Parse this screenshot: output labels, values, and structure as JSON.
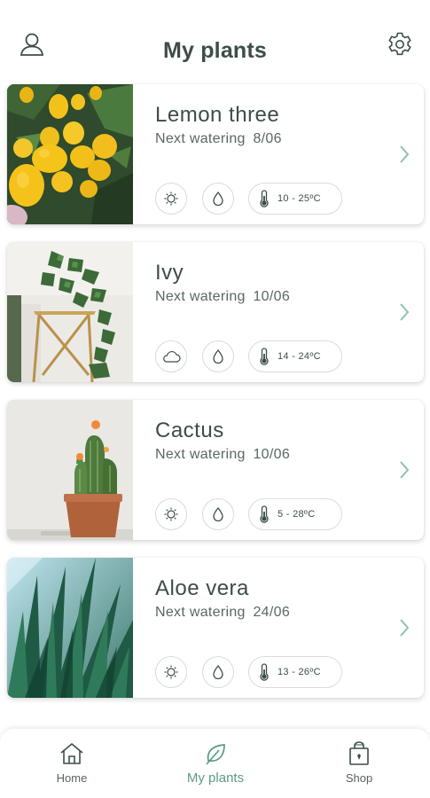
{
  "header": {
    "title": "My plants",
    "left_icon": "user-icon",
    "right_icon": "gear-icon"
  },
  "colors": {
    "accent": "#5a9c80",
    "text": "#3d4d48",
    "chip_border": "#d6dcd9"
  },
  "plants": [
    {
      "name": "Lemon three",
      "watering_label": "Next watering",
      "watering_date": "8/06",
      "light_icon": "sun-icon",
      "water_icon": "water-drop-icon",
      "temp_icon": "thermometer-icon",
      "temperature": "10 - 25ºC"
    },
    {
      "name": "Ivy",
      "watering_label": "Next watering",
      "watering_date": "10/06",
      "light_icon": "cloud-icon",
      "water_icon": "water-drop-icon",
      "temp_icon": "thermometer-icon",
      "temperature": "14 - 24ºC"
    },
    {
      "name": "Cactus",
      "watering_label": "Next watering",
      "watering_date": "10/06",
      "light_icon": "sun-icon",
      "water_icon": "water-drop-icon",
      "temp_icon": "thermometer-icon",
      "temperature": "5 - 28ºC"
    },
    {
      "name": "Aloe vera",
      "watering_label": "Next watering",
      "watering_date": "24/06",
      "light_icon": "sun-icon",
      "water_icon": "water-drop-icon",
      "temp_icon": "thermometer-icon",
      "temperature": "13 - 26ºC"
    }
  ],
  "nav": {
    "items": [
      {
        "label": "Home",
        "icon": "home-icon",
        "active": false
      },
      {
        "label": "My plants",
        "icon": "leaf-icon",
        "active": true
      },
      {
        "label": "Shop",
        "icon": "shopping-bag-icon",
        "active": false
      }
    ]
  }
}
